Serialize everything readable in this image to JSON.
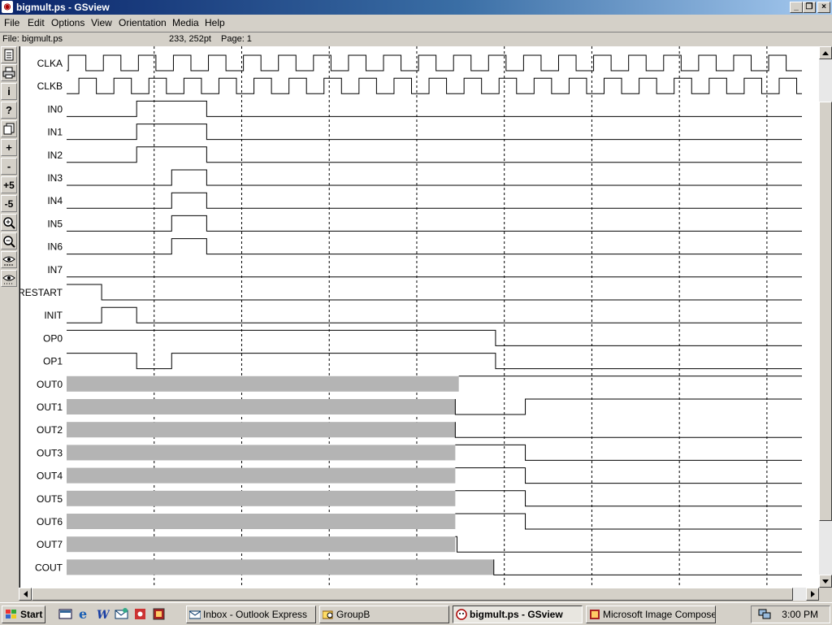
{
  "window": {
    "title": "bigmult.ps - GSview",
    "controls": {
      "minimize": "_",
      "maximize": "❐",
      "close": "×"
    }
  },
  "menu": [
    "File",
    "Edit",
    "Options",
    "View",
    "Orientation",
    "Media",
    "Help"
  ],
  "status": {
    "file": "File: bigmult.ps",
    "coords": "233, 252pt",
    "page": "Page: 1"
  },
  "toolbar": [
    {
      "icon": "open-file-icon",
      "label": ""
    },
    {
      "icon": "print-icon",
      "label": ""
    },
    {
      "icon": "info-icon",
      "label": "i"
    },
    {
      "icon": "help-icon",
      "label": "?"
    },
    {
      "icon": "goto-page-icon",
      "label": ""
    },
    {
      "icon": "next-page-icon",
      "label": "+"
    },
    {
      "icon": "previous-page-icon",
      "label": "-"
    },
    {
      "icon": "forward-5-icon",
      "label": "+5"
    },
    {
      "icon": "back-5-icon",
      "label": "-5"
    },
    {
      "icon": "zoom-in-icon",
      "label": ""
    },
    {
      "icon": "zoom-out-icon",
      "label": ""
    },
    {
      "icon": "magnify-abc-icon",
      "label": ""
    },
    {
      "icon": "magnify-dots-icon",
      "label": ""
    }
  ],
  "taskbar": {
    "start_label": "Start",
    "quick_launch": [
      "show-desktop-icon",
      "internet-explorer-icon",
      "word-icon",
      "outlook-express-icon",
      "app-icon",
      "app-icon-2"
    ],
    "tasks": [
      {
        "label": "Inbox - Outlook Express",
        "icon": "outlook-express-icon",
        "active": false
      },
      {
        "label": "GroupB",
        "icon": "folder-search-icon",
        "active": false
      },
      {
        "label": "bigmult.ps - GSview",
        "icon": "gsview-icon",
        "active": true
      },
      {
        "label": "Microsoft Image Composer",
        "icon": "image-composer-icon",
        "active": false
      }
    ],
    "tray_icon": "network-icon",
    "clock": "3:00 PM"
  },
  "colors": {
    "title_start": "#0a246a",
    "title_end": "#a6caf0",
    "undefined_fill": "#b4b4b4",
    "window_bg": "#d4d0c8"
  },
  "waveform": {
    "signals": [
      {
        "name": "CLKA",
        "kind": "clock"
      },
      {
        "name": "CLKB",
        "kind": "clock"
      },
      {
        "name": "IN0",
        "kind": "digital",
        "initial": 0,
        "toggles": [
          2,
          4
        ]
      },
      {
        "name": "IN1",
        "kind": "digital",
        "initial": 0,
        "toggles": [
          2,
          4
        ]
      },
      {
        "name": "IN2",
        "kind": "digital",
        "initial": 0,
        "toggles": [
          2,
          4
        ]
      },
      {
        "name": "IN3",
        "kind": "digital",
        "initial": 0,
        "toggles": [
          3,
          4
        ]
      },
      {
        "name": "IN4",
        "kind": "digital",
        "initial": 0,
        "toggles": [
          3,
          4
        ]
      },
      {
        "name": "IN5",
        "kind": "digital",
        "initial": 0,
        "toggles": [
          3,
          4
        ]
      },
      {
        "name": "IN6",
        "kind": "digital",
        "initial": 0,
        "toggles": [
          3,
          4
        ]
      },
      {
        "name": "IN7",
        "kind": "digital",
        "initial": 0,
        "toggles": []
      },
      {
        "name": "RESTART",
        "kind": "digital",
        "initial": 1,
        "toggles": [
          1
        ]
      },
      {
        "name": "INIT",
        "kind": "digital",
        "initial": 0,
        "toggles": [
          1,
          2
        ]
      },
      {
        "name": "OP0",
        "kind": "digital",
        "initial": 1,
        "toggles": [
          12.25
        ]
      },
      {
        "name": "OP1",
        "kind": "digital",
        "initial": 1,
        "toggles": [
          2,
          3,
          12.25
        ]
      },
      {
        "name": "OUT0",
        "kind": "bus",
        "unknown_until": 11.2,
        "initial": 1,
        "toggles": []
      },
      {
        "name": "OUT1",
        "kind": "bus",
        "unknown_until": 11.1,
        "initial": 0,
        "toggles": [
          13.1
        ]
      },
      {
        "name": "OUT2",
        "kind": "bus",
        "unknown_until": 11.1,
        "initial": 0,
        "toggles": []
      },
      {
        "name": "OUT3",
        "kind": "bus",
        "unknown_until": 11.1,
        "initial": 1,
        "toggles": [
          13.1
        ]
      },
      {
        "name": "OUT4",
        "kind": "bus",
        "unknown_until": 11.1,
        "initial": 1,
        "toggles": [
          13.1
        ]
      },
      {
        "name": "OUT5",
        "kind": "bus",
        "unknown_until": 11.1,
        "initial": 1,
        "toggles": [
          13.1
        ]
      },
      {
        "name": "OUT6",
        "kind": "bus",
        "unknown_until": 11.1,
        "initial": 1,
        "toggles": [
          13.1
        ]
      },
      {
        "name": "OUT7",
        "kind": "bus",
        "unknown_until": 11.1,
        "initial": 1,
        "toggles": [
          11.15
        ]
      },
      {
        "name": "COUT",
        "kind": "bus",
        "unknown_until": 12.2,
        "initial": 0,
        "toggles": []
      }
    ],
    "time_end": 21,
    "gridline_times": [
      2.5,
      5,
      7.5,
      10,
      12.5,
      15,
      17.5,
      20
    ]
  }
}
